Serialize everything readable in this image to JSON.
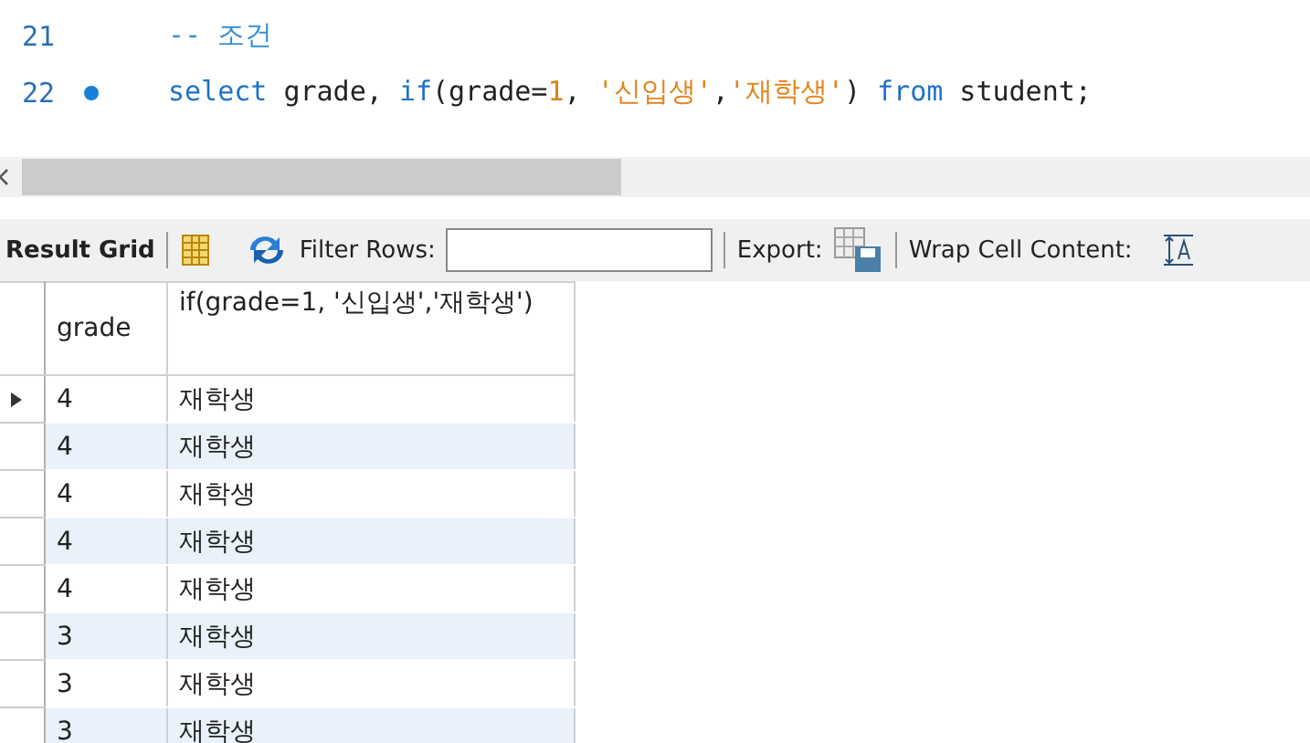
{
  "editor": {
    "lines": [
      {
        "number": "21",
        "breakpoint": false,
        "tokens": [
          {
            "kind": "comment",
            "text": "-- 조건"
          }
        ]
      },
      {
        "number": "22",
        "breakpoint": true,
        "tokens": [
          {
            "kind": "keyword",
            "text": "select"
          },
          {
            "kind": "plain",
            "text": " grade, "
          },
          {
            "kind": "keyword",
            "text": "if"
          },
          {
            "kind": "plain",
            "text": "(grade="
          },
          {
            "kind": "number",
            "text": "1"
          },
          {
            "kind": "plain",
            "text": ", "
          },
          {
            "kind": "string",
            "text": "'신입생'"
          },
          {
            "kind": "plain",
            "text": ","
          },
          {
            "kind": "string",
            "text": "'재학생'"
          },
          {
            "kind": "plain",
            "text": ") "
          },
          {
            "kind": "keyword",
            "text": "from"
          },
          {
            "kind": "plain",
            "text": " student;"
          }
        ]
      }
    ]
  },
  "toolbar": {
    "title": "Result Grid",
    "filter_label": "Filter Rows:",
    "export_label": "Export:",
    "wrap_label": "Wrap Cell Content:"
  },
  "table": {
    "columns": [
      "grade",
      "if(grade=1, '신입생','재학생')"
    ],
    "rows": [
      {
        "selected": true,
        "cells": [
          "4",
          "재학생"
        ]
      },
      {
        "selected": false,
        "cells": [
          "4",
          "재학생"
        ]
      },
      {
        "selected": false,
        "cells": [
          "4",
          "재학생"
        ]
      },
      {
        "selected": false,
        "cells": [
          "4",
          "재학생"
        ]
      },
      {
        "selected": false,
        "cells": [
          "4",
          "재학생"
        ]
      },
      {
        "selected": false,
        "cells": [
          "3",
          "재학생"
        ]
      },
      {
        "selected": false,
        "cells": [
          "3",
          "재학생"
        ]
      },
      {
        "selected": false,
        "cells": [
          "3",
          "재학생"
        ]
      }
    ]
  }
}
